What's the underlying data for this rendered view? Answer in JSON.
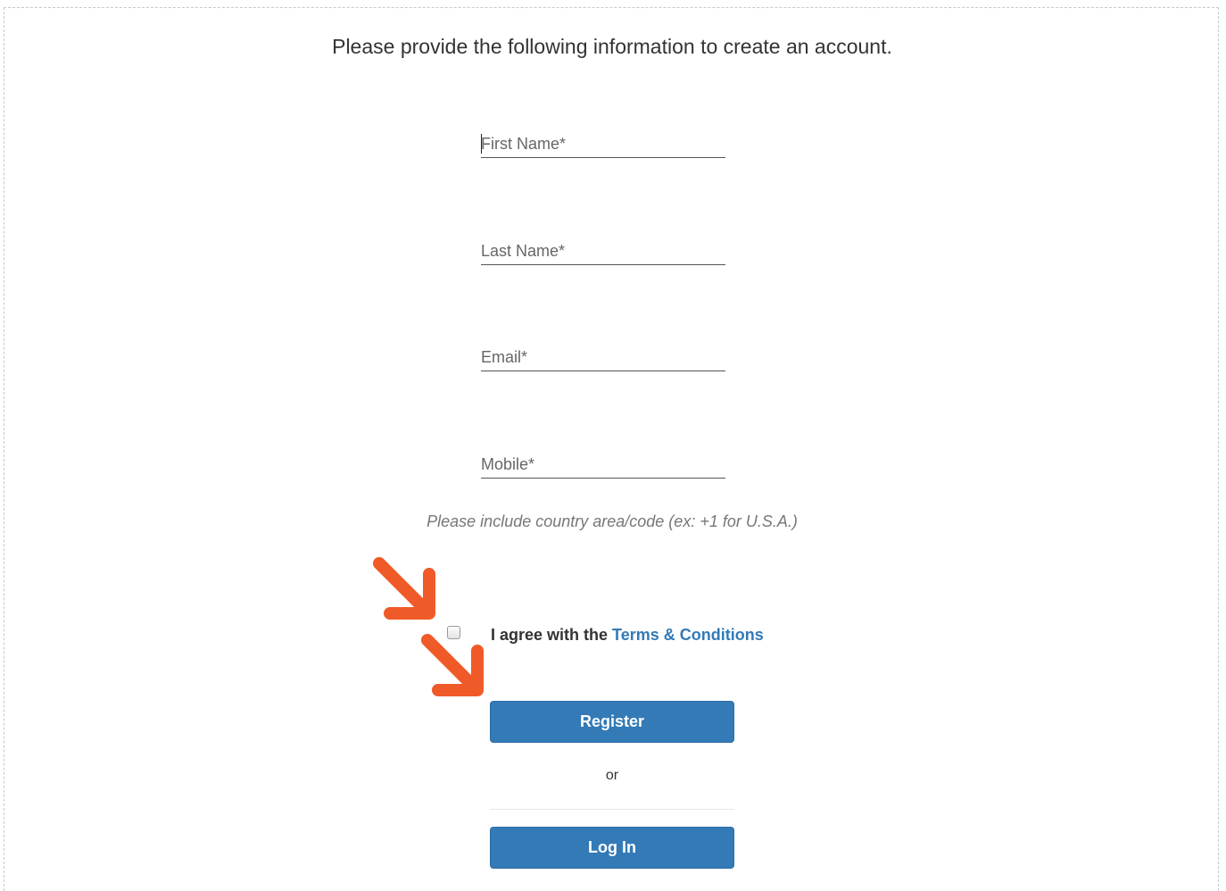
{
  "intro_text": "Please provide the following information to create an account.",
  "fields": {
    "first_name": {
      "placeholder": "First Name*",
      "value": ""
    },
    "last_name": {
      "placeholder": "Last Name*",
      "value": ""
    },
    "email": {
      "placeholder": "Email*",
      "value": ""
    },
    "mobile": {
      "placeholder": "Mobile*",
      "value": ""
    }
  },
  "mobile_hint": "Please include country area/code (ex: +1 for U.S.A.)",
  "terms": {
    "prefix": "I agree with the",
    "link_label": "Terms & Conditions",
    "checked": false
  },
  "register_label": "Register",
  "or_text": "or",
  "login_label": "Log In",
  "colors": {
    "primary_button": "#337ab7",
    "link": "#337ab7",
    "annotation_arrow": "#f05a28"
  },
  "icons": [
    "annotation-arrow-icon",
    "checkbox-icon"
  ]
}
